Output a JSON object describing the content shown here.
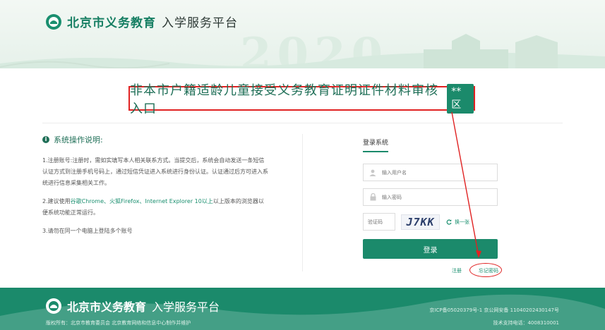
{
  "header": {
    "logo_strong": "北京市义务教育",
    "logo_light": "入学服务平台",
    "watermark_year": "2020"
  },
  "page_title": {
    "text": "非本市户籍适龄儿童接受义务教育证明证件材料审核入口",
    "district": "**区"
  },
  "instructions": {
    "heading": "系统操作说明:",
    "items": [
      "1.注册账号:注册时，需如实填写本人相关联系方式。当提交后，系统会自动发送一条短信认证方式到注册手机号码上，通过短信凭证进入系统进行身份认证。认证通过后方可进入系统进行信息采集相关工作。",
      "3.请勿在同一个电脑上登陆多个账号"
    ],
    "item2_pre": "2.建议使用",
    "item2_link": "谷歌Chrome、火狐Firefox、Internet Explorer 10以上",
    "item2_post": "以上版本的浏览器以便系统功能正常运行。"
  },
  "login": {
    "title": "登录系统",
    "username_placeholder": "输入用户名",
    "password_placeholder": "输入密码",
    "captcha_placeholder": "验证码",
    "captcha_text": "J7KK",
    "refresh_label": "换一张",
    "submit_label": "登录",
    "register_link": "注册",
    "forgot_link": "忘记密码"
  },
  "footer": {
    "logo_strong": "北京市义务教育",
    "logo_light": "入学服务平台",
    "copyright": "版权所有：北京市教育委员会 北京教育网络和信息中心制作并维护",
    "icp": "京ICP备05020379号-1 京公网安备 11040202430147号",
    "tel": "技术支持电话：4008310001"
  },
  "colors": {
    "brand": "#1b8a6b",
    "annotation": "#e02222"
  }
}
